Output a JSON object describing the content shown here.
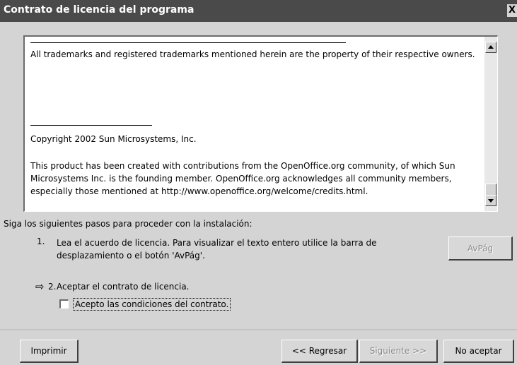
{
  "window": {
    "title": "Contrato de licencia del programa",
    "close_label": "X"
  },
  "license": {
    "paragraphs": [
      "All trademarks and registered trademarks mentioned herein are the property of their respective owners.",
      "Copyright 2002 Sun Microsystems, Inc.",
      "This product has been created with contributions from the OpenOffice.org community, of which Sun Microsystems Inc. is the founding member. OpenOffice.org acknowledges all community members, especially those mentioned at http://www.openoffice.org/welcome/credits.html."
    ]
  },
  "instructions": {
    "intro": "Siga los siguientes pasos para proceder con la instalación:",
    "step1_number": "1.",
    "step1_text": "Lea el acuerdo de licencia. Para visualizar el texto entero utilice la barra de desplazamiento o el botón 'AvPág'.",
    "step2_number": "2.",
    "step2_text": "Aceptar el contrato de licencia.",
    "checkbox_label": "Acepto las condiciones del contrato.",
    "checkbox_checked": false
  },
  "buttons": {
    "avpag": "AvPág",
    "print": "Imprimir",
    "back": "<< Regresar",
    "next": "Siguiente >>",
    "decline": "No aceptar"
  },
  "icons": {
    "step_arrow": "arrow-right-icon"
  }
}
